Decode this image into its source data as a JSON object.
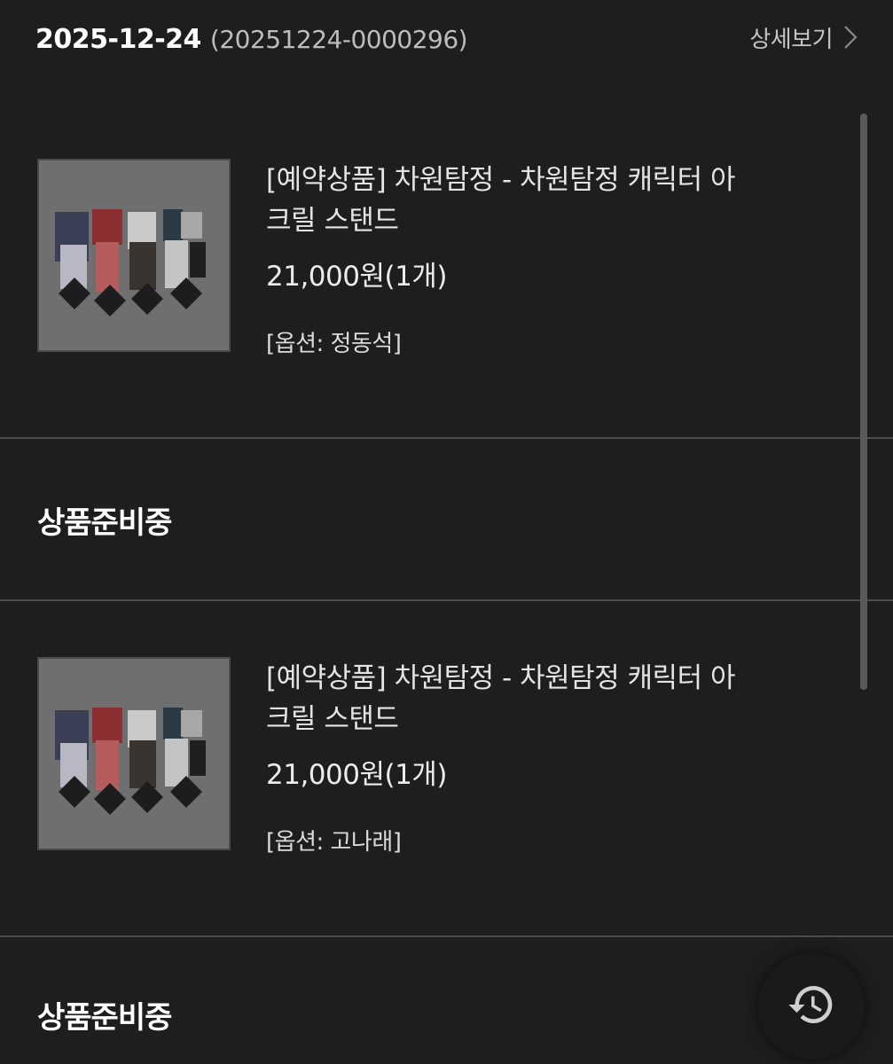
{
  "order": {
    "date": "2025-12-24",
    "number": "(20251224-0000296)",
    "detail_label": "상세보기"
  },
  "items": [
    {
      "name_line1": "[예약상품] 차원탐정 - 차원탐정 캐릭터 아",
      "name_line2": "크릴 스탠드",
      "price": "21,000원(1개)",
      "option": "[옵션: 정동석]",
      "status": "상품준비중"
    },
    {
      "name_line1": "[예약상품] 차원탐정 - 차원탐정 캐릭터 아",
      "name_line2": "크릴 스탠드",
      "price": "21,000원(1개)",
      "option": "[옵션: 고나래]",
      "status": "상품준비중"
    }
  ],
  "icons": {
    "detail": "chevron-right-icon",
    "history": "history-icon"
  }
}
